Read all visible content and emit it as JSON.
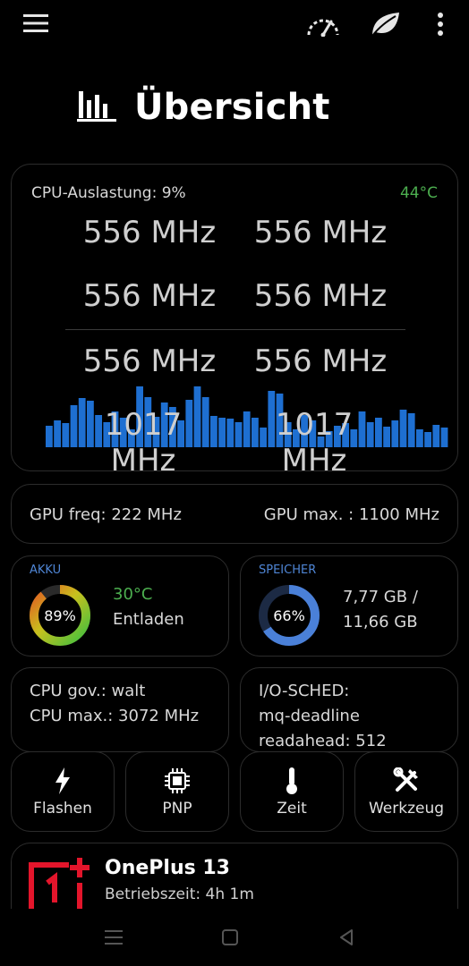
{
  "header": {
    "title": "Übersicht",
    "icons": [
      "menu-icon",
      "speedometer-icon",
      "leaf-icon",
      "more-vert-icon",
      "bar-chart-icon"
    ]
  },
  "cpu": {
    "load_label": "CPU-Auslastung: 9%",
    "temp": "44°C",
    "freqs": [
      "556 MHz",
      "556 MHz",
      "556 MHz",
      "556 MHz",
      "556 MHz",
      "556 MHz",
      "1017 MHz",
      "1017 MHz"
    ],
    "history": [
      24,
      30,
      27,
      47,
      55,
      52,
      36,
      28,
      40,
      33,
      20,
      68,
      56,
      34,
      50,
      45,
      30,
      53,
      68,
      56,
      35,
      33,
      32,
      28,
      40,
      33,
      22,
      63,
      60,
      28,
      20,
      36,
      30,
      12,
      18,
      24,
      27,
      20,
      40,
      28,
      33,
      23,
      30,
      42,
      38,
      20,
      17,
      25,
      22
    ]
  },
  "gpu": {
    "freq": "GPU freq: 222 MHz",
    "max": "GPU max. : 1100 MHz"
  },
  "akku": {
    "heading": "AKKU",
    "percent": "89%",
    "level": 0.89,
    "temp": "30°C",
    "status": "Entladen"
  },
  "speicher": {
    "heading": "SPEICHER",
    "percent": "66%",
    "level": 0.66,
    "used": "7,77 GB /",
    "total": "11,66 GB"
  },
  "governor": {
    "gov": "CPU gov.: walt",
    "max": "CPU max.: 3072 MHz"
  },
  "io": {
    "sched_label": "I/O-SCHED:",
    "sched": "mq-deadline",
    "readahead": "readahead: 512"
  },
  "tiles": [
    {
      "label": "Flashen",
      "icon": "flash-icon"
    },
    {
      "label": "PNP",
      "icon": "chip-icon"
    },
    {
      "label": "Zeit",
      "icon": "thermometer-icon"
    },
    {
      "label": "Werkzeug",
      "icon": "tools-icon"
    }
  ],
  "device": {
    "name": "OnePlus 13",
    "uptime": "Betriebszeit: 4h 1m"
  },
  "colors": {
    "accent_blue": "#1e6fd1",
    "temp_green": "#4cae4f",
    "akku_head": "#4f86d6",
    "oneplus_red": "#e3152b"
  }
}
